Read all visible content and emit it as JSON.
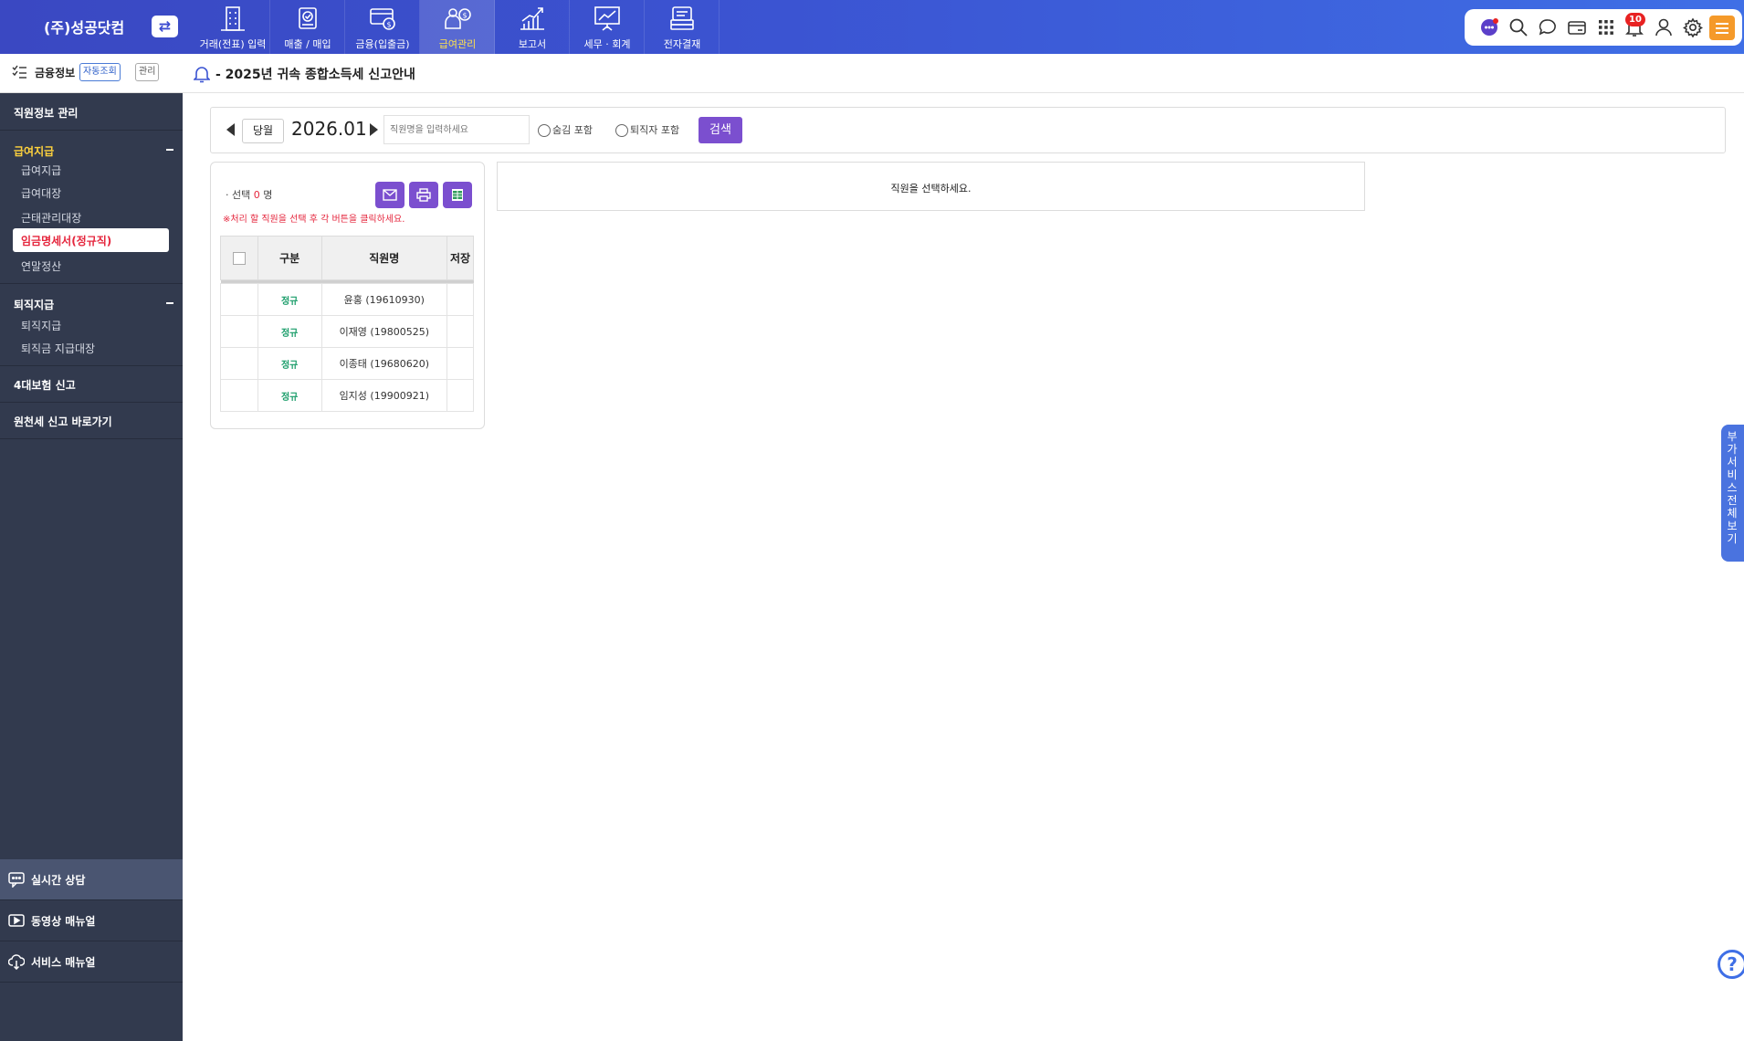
{
  "header": {
    "company": "(주)성공닷컴",
    "switch_icon": "swap-arrows-icon",
    "nav": [
      {
        "label": "거래(전표) 입력",
        "icon": "building-icon"
      },
      {
        "label": "매출 / 매입",
        "icon": "document-check-icon"
      },
      {
        "label": "금융(입출금)",
        "icon": "card-coin-icon"
      },
      {
        "label": "급여관리",
        "icon": "payroll-person-icon",
        "active": true
      },
      {
        "label": "보고서",
        "icon": "chart-up-icon"
      },
      {
        "label": "세무 · 회계",
        "icon": "presentation-chart-icon"
      },
      {
        "label": "전자결재",
        "icon": "approval-stack-icon"
      }
    ],
    "notification_count": "10",
    "accent_color": "#ffe14d",
    "menu_button_color": "#f59a2a"
  },
  "sidebar": {
    "finance_label": "금융정보",
    "auto_query_chip": "자동조회",
    "manage_chip": "관리",
    "employee_info": "직원정보 관리",
    "payroll": {
      "title": "급여지급",
      "items": [
        "급여지급",
        "급여대장",
        "근태관리대장",
        "임금명세서(정규직)",
        "연말정산"
      ],
      "active_index": 3
    },
    "retirement": {
      "title": "퇴직지급",
      "items": [
        "퇴직지급",
        "퇴직금 지급대장"
      ]
    },
    "insurance": "4대보험 신고",
    "withholding": "원천세 신고 바로가기",
    "bottom": [
      {
        "label": "실시간 상담",
        "icon": "chat-bubble-icon"
      },
      {
        "label": "동영상 매뉴얼",
        "icon": "video-play-icon"
      },
      {
        "label": "서비스 매뉴얼",
        "icon": "cloud-download-icon"
      }
    ]
  },
  "notice": "- 2025년 귀속 종합소득세 신고안내",
  "filter": {
    "current_month_button": "당월",
    "period": "2026.01",
    "employee_placeholder": "직원명을 입력하세요",
    "include_hidden": "숨김 포함",
    "include_retired": "퇴직자 포함",
    "search_button": "검색"
  },
  "employee_list": {
    "selected_prefix": "· 선택",
    "selected_count": "0",
    "selected_suffix": "명",
    "hint": "※처리 할 직원을 선택 후 각 버튼을 클릭하세요.",
    "action_icons": [
      "mail-icon",
      "print-icon",
      "excel-icon"
    ],
    "columns": [
      "",
      "구분",
      "직원명",
      "저장"
    ],
    "rows": [
      {
        "type": "정규",
        "name": "윤홍 (19610930)",
        "saved": ""
      },
      {
        "type": "정규",
        "name": "이재영 (19800525)",
        "saved": ""
      },
      {
        "type": "정규",
        "name": "이종태 (19680620)",
        "saved": ""
      },
      {
        "type": "정규",
        "name": "임지성 (19900921)",
        "saved": ""
      }
    ]
  },
  "detail_panel": {
    "message": "직원을 선택하세요."
  },
  "side_tab": "부가서비스 전체보기",
  "help_label": "?"
}
